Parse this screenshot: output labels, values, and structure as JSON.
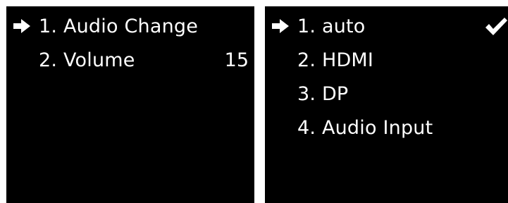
{
  "audio_menu": {
    "items": [
      {
        "label": "1. Audio Change",
        "value": "",
        "selected": true
      },
      {
        "label": "2. Volume",
        "value": "15",
        "selected": false
      }
    ],
    "pointer_icon": "right-arrow-pointer-icon"
  },
  "audio_change_menu": {
    "items": [
      {
        "label": "1. auto",
        "selected": true,
        "checked": true
      },
      {
        "label": "2. HDMI",
        "selected": false,
        "checked": false
      },
      {
        "label": "3. DP",
        "selected": false,
        "checked": false
      },
      {
        "label": "4. Audio Input",
        "selected": false,
        "checked": false
      }
    ],
    "pointer_icon": "right-arrow-pointer-icon",
    "check_icon": "checkmark-icon"
  },
  "colors": {
    "panel_background": "#000000",
    "text": "#ffffff",
    "page_background": "#ffffff"
  }
}
